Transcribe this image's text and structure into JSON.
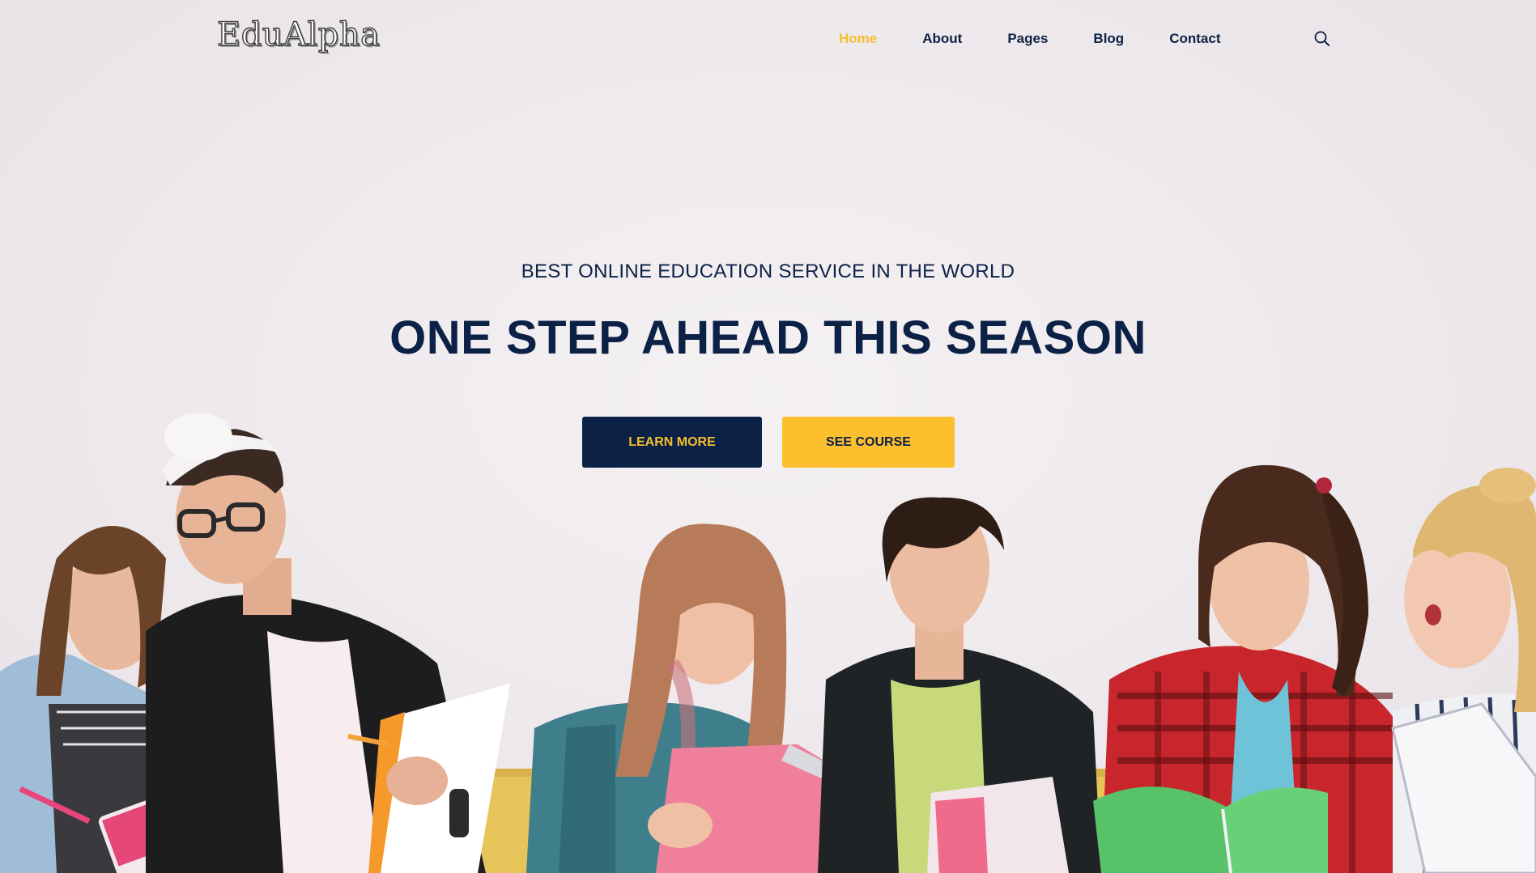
{
  "header": {
    "logo_text": "EduAlpha",
    "nav": [
      {
        "label": "Home",
        "active": true
      },
      {
        "label": "About",
        "active": false
      },
      {
        "label": "Pages",
        "active": false
      },
      {
        "label": "Blog",
        "active": false
      },
      {
        "label": "Contact",
        "active": false
      }
    ],
    "search_icon": "search-icon"
  },
  "hero": {
    "subtitle": "BEST ONLINE EDUCATION SERVICE IN THE WORLD",
    "title": "ONE STEP AHEAD THIS SEASON",
    "learn_more_label": "LEARN MORE",
    "see_course_label": "SEE COURSE",
    "image": "students-reading-notebooks-photo"
  },
  "colors": {
    "navy": "#0c2146",
    "accent_yellow": "#f5bf2c",
    "background": "#ece7ea"
  }
}
